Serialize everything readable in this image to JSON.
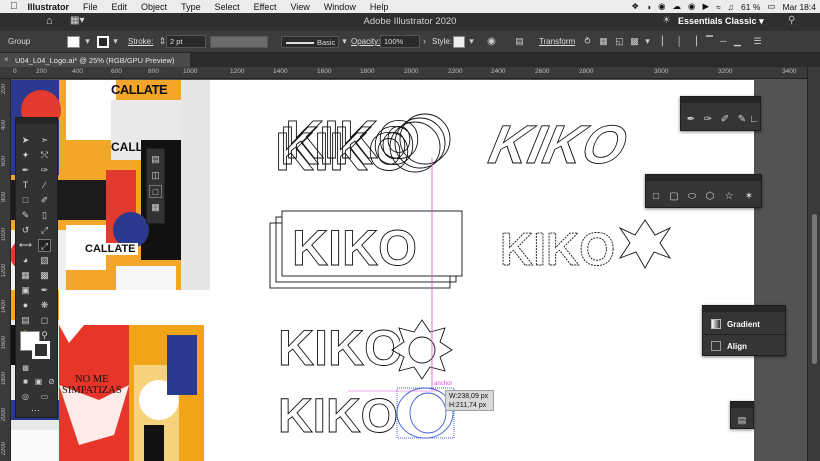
{
  "menubar": {
    "app_name": "Illustrator",
    "items": [
      "File",
      "Edit",
      "Object",
      "Type",
      "Select",
      "Effect",
      "View",
      "Window",
      "Help"
    ],
    "battery": "61 %",
    "clock": "Mar 18:4"
  },
  "titlebar": {
    "title": "Adobe Illustrator 2020",
    "workspace": "Essentials Classic"
  },
  "control": {
    "selection_type": "Group",
    "stroke_label": "Stroke:",
    "stroke_value": "2 pt",
    "brush_value": "Basic",
    "opacity_label": "Opacity:",
    "opacity_value": "100%",
    "style_label": "Style:",
    "transform_label": "Transform"
  },
  "document": {
    "tab_title": "U04_L04_Logo.ai* @ 25% (RGB/GPU Preview)"
  },
  "rulers": {
    "h_ticks": [
      "0",
      "200",
      "400",
      "600",
      "800",
      "1000",
      "1200",
      "1400",
      "1600",
      "1800",
      "2000",
      "2200",
      "2400",
      "2600",
      "2800",
      "3000",
      "3200",
      "3400"
    ],
    "v_ticks": [
      "200",
      "400",
      "600",
      "800",
      "1000",
      "1200",
      "1400",
      "1600",
      "1800",
      "2000",
      "2200"
    ]
  },
  "artwork": {
    "logo_text": "KIKO",
    "callate": "CALLATE",
    "no_me": "NO ME",
    "simpatizas": "SIMPATIZAS"
  },
  "measure": {
    "width": "W:238,09 px",
    "height": "H:211,74 px",
    "hint": "anchor"
  },
  "panels": {
    "gradient": "Gradient",
    "align": "Align"
  },
  "colors": {
    "menubar_bg": "#ececec",
    "ui_dark": "#323232",
    "selection": "#3c5dd6",
    "smart_guide": "#d94fd6"
  }
}
